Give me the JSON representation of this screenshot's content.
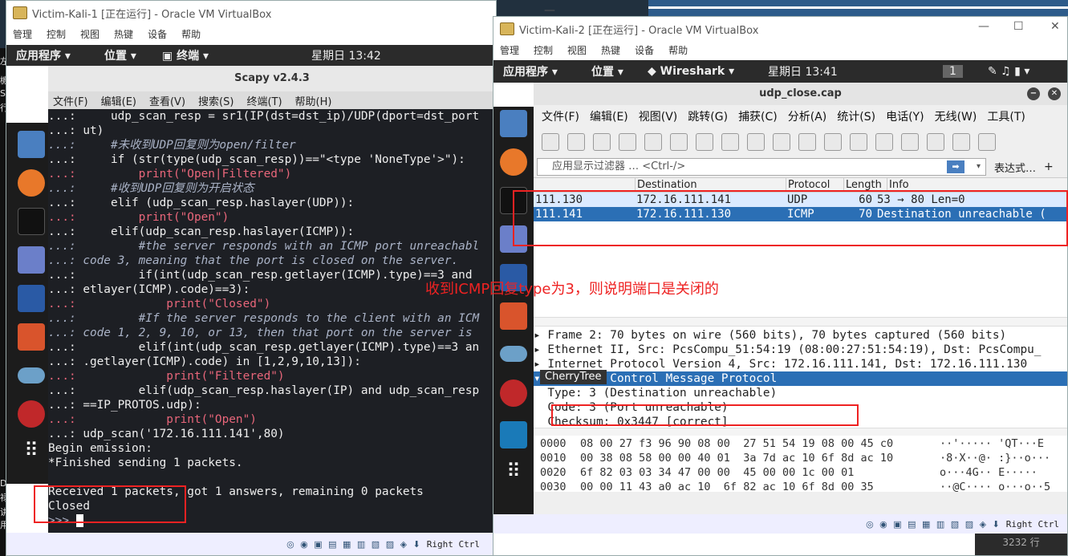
{
  "host": {
    "chars": [
      "左",
      "機",
      "S",
      "行",
      "D",
      "禄",
      "讲",
      "用"
    ]
  },
  "vm1": {
    "title": "Victim-Kali-1 [正在运行] - Oracle VM VirtualBox",
    "menu": [
      "管理",
      "控制",
      "视图",
      "热键",
      "设备",
      "帮助"
    ],
    "topbar": {
      "apps": "应用程序",
      "places": "位置",
      "terminal": "终端",
      "clock": "星期日 13:42"
    },
    "term_title": "Scapy v2.4.3",
    "term_menu": [
      "文件(F)",
      "编辑(E)",
      "查看(V)",
      "搜索(S)",
      "终端(T)",
      "帮助(H)"
    ],
    "lines": [
      "...:     udp_scan_resp = sr1(IP(dst=dst_ip)/UDP(dport=dst_port",
      "...: ut)",
      "...:     #未收到UDP回复则为open/filter",
      "...:     if (str(type(udp_scan_resp))==\"<type 'NoneType'>\"):",
      "...:         print(\"Open|Filtered\")",
      "...:     #收到UDP回复则为开启状态",
      "...:     elif (udp_scan_resp.haslayer(UDP)):",
      "...:         print(\"Open\")",
      "...:     elif(udp_scan_resp.haslayer(ICMP)):",
      "...:         #the server responds with an ICMP port unreachabl",
      "...: code 3, meaning that the port is closed on the server.",
      "...:         if(int(udp_scan_resp.getlayer(ICMP).type)==3 and",
      "...: etlayer(ICMP).code)==3):",
      "...:             print(\"Closed\")",
      "...:         #If the server responds to the client with an ICM",
      "...: code 1, 2, 9, 10, or 13, then that port on the server is",
      "...:         elif(int(udp_scan_resp.getlayer(ICMP).type)==3 an",
      "...: .getlayer(ICMP).code) in [1,2,9,10,13]):",
      "...:             print(\"Filtered\")",
      "...:         elif(udp_scan_resp.haslayer(IP) and udp_scan_resp",
      "...: ==IP_PROTOS.udp):",
      "...:             print(\"Open\")",
      "...: udp_scan('172.16.111.141',80)",
      "Begin emission:",
      "*Finished sending 1 packets.",
      "",
      "Received 1 packets, got 1 answers, remaining 0 packets",
      "Closed",
      ">>> "
    ],
    "status": "Right Ctrl"
  },
  "vm2": {
    "title": "Victim-Kali-2 [正在运行] - Oracle VM VirtualBox",
    "menu": [
      "管理",
      "控制",
      "视图",
      "热键",
      "设备",
      "帮助"
    ],
    "topbar": {
      "apps": "应用程序",
      "places": "位置",
      "wireshark": "Wireshark",
      "clock": "星期日 13:41",
      "workspace": "1"
    },
    "ws_title": "udp_close.cap",
    "ws_menu": [
      "文件(F)",
      "编辑(E)",
      "视图(V)",
      "跳转(G)",
      "捕获(C)",
      "分析(A)",
      "统计(S)",
      "电话(Y)",
      "无线(W)",
      "工具(T)"
    ],
    "filter_placeholder": "应用显示过滤器 … <Ctrl-/>",
    "expr_label": "表达式…",
    "columns": [
      "Destination",
      "Protocol",
      "Length",
      "Info"
    ],
    "packets": [
      {
        "src": "111.130",
        "dst": "172.16.111.141",
        "proto": "UDP",
        "len": "60",
        "info": "53 → 80 Len=0"
      },
      {
        "src": "111.141",
        "dst": "172.16.111.130",
        "proto": "ICMP",
        "len": "70",
        "info": "Destination unreachable ("
      }
    ],
    "annotation": "收到ICMP回复type为3，则说明端口是关闭的",
    "details": [
      "Frame 2: 70 bytes on wire (560 bits), 70 bytes captured (560 bits)",
      "Ethernet II, Src: PcsCompu_51:54:19 (08:00:27:51:54:19), Dst: PcsCompu_",
      "Internet Protocol Version 4, Src: 172.16.111.141, Dst: 172.16.111.130",
      "Internet Control Message Protocol",
      "  Type: 3 (Destination unreachable)",
      "  Code: 3 (Port unreachable)",
      "  Checksum: 0x3447 [correct]"
    ],
    "tooltip": "CherryTree",
    "hex": [
      {
        "off": "0000",
        "bytes": "08 00 27 f3 96 90 08 00  27 51 54 19 08 00 45 c0",
        "ascii": "··'····· 'QT···E"
      },
      {
        "off": "0010",
        "bytes": "00 38 08 58 00 00 40 01  3a 7d ac 10 6f 8d ac 10",
        "ascii": "·8·X··@· :}··o···"
      },
      {
        "off": "0020",
        "bytes": "6f 82 03 03 34 47 00 00  45 00 00 1c 00 01",
        "ascii": "o···4G·· E·····"
      },
      {
        "off": "0030",
        "bytes": "00 00 11 43 a0 ac 10  6f 82 ac 10 6f 8d 00 35",
        "ascii": "··@C···· o···o··5"
      }
    ],
    "status": "Right Ctrl",
    "corner": "3232 行"
  }
}
